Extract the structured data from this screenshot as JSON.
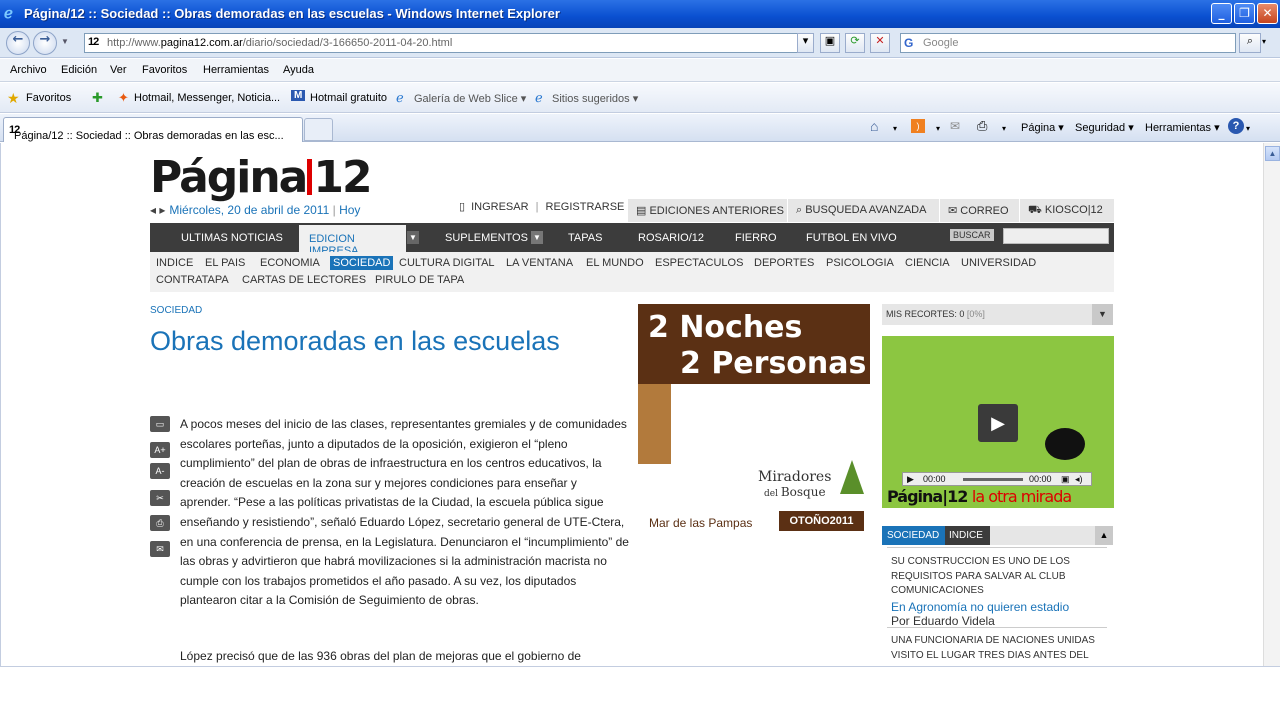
{
  "window": {
    "title": "Página/12 :: Sociedad :: Obras demoradas en las escuelas - Windows Internet Explorer"
  },
  "addressbar": {
    "favicon": "12",
    "url_prefix": "http://www.",
    "url_domain": "pagina12.com.ar",
    "url_path": "/diario/sociedad/3-166650-2011-04-20.html",
    "search_placeholder": "Google"
  },
  "menubar": {
    "items": [
      "Archivo",
      "Edición",
      "Ver",
      "Favoritos",
      "Herramientas",
      "Ayuda"
    ]
  },
  "favoritesbar": {
    "favorites_label": "Favoritos",
    "items": [
      "Hotmail, Messenger, Noticia...",
      "Hotmail gratuito",
      "Galería de Web Slice ▾",
      "Sitios sugeridos ▾"
    ]
  },
  "tabs": {
    "active_label": "Página/12 :: Sociedad :: Obras demoradas en las esc...",
    "tools": [
      "Página ▾",
      "Seguridad ▾",
      "Herramientas ▾"
    ]
  },
  "site": {
    "logo_left": "Página",
    "logo_right": "12",
    "date": "Miércoles, 20 de abril de 2011",
    "date_sep": "|",
    "today": "Hoy",
    "login": "INGRESAR",
    "register": "REGISTRARSE",
    "util_sep": "|",
    "tabs": [
      "EDICIONES ANTERIORES",
      "BUSQUEDA AVANZADA",
      "CORREO",
      "KIOSCO|12"
    ],
    "mainnav": {
      "item0": "ULTIMAS NOTICIAS",
      "active": "EDICION IMPRESA",
      "item2": "SUPLEMENTOS",
      "item3": "TAPAS",
      "item4": "ROSARIO/12",
      "item5": "FIERRO",
      "item6": "FUTBOL EN VIVO",
      "search_btn": "BUSCAR"
    },
    "subnav": [
      "INDICE",
      "EL PAIS",
      "ECONOMIA",
      "SOCIEDAD",
      "CULTURA DIGITAL",
      "LA VENTANA",
      "EL MUNDO",
      "ESPECTACULOS",
      "DEPORTES",
      "PSICOLOGIA",
      "CIENCIA",
      "UNIVERSIDAD",
      "CONTRATAPA",
      "CARTAS DE LECTORES",
      "PIRULO DE TAPA"
    ]
  },
  "article": {
    "section": "SOCIEDAD",
    "headline": "Obras demoradas en las escuelas",
    "para1": "A pocos meses del inicio de las clases, representantes gremiales y de comunidades escolares porteñas, junto a diputados de la oposición, exigieron el “pleno cumplimiento” del plan de obras de infraestructura en los centros educativos, la creación de escuelas en la zona sur y mejores condiciones para enseñar y aprender. “Pese a las políticas privatistas de la Ciudad, la escuela pública sigue enseñando y resistiendo”, señaló Eduardo López, secretario general de UTE-Ctera, en una conferencia de prensa, en la Legislatura. Denunciaron el “incumplimiento” de las obras y advirtieron que habrá movilizaciones si la administración macrista no cumple con los trabajos prometidos el año pasado. A su vez, los diputados plantearon citar a la Comisión de Seguimiento de obras.",
    "para2": "López precisó que de las 936 obras del plan de mejoras que el gobierno de",
    "tools": [
      "A+",
      "A-"
    ]
  },
  "ad": {
    "line1": "2 Noches",
    "line2": "2 Personas",
    "brand_top": "Miradores",
    "brand_mid": "del",
    "brand_bottom": "Bosque",
    "place": "Mar de las Pampas",
    "season": "OTOÑO2011"
  },
  "sidebar": {
    "recortes_label": "MIS RECORTES: 0",
    "recortes_pct": "[0%]",
    "video_time_start": "00:00",
    "video_time_end": "00:00",
    "video_caption_logo": "Página|12",
    "video_caption_tag": "la otra mirada",
    "tab_active": "SOCIEDAD",
    "tab_other": "INDICE",
    "news1_kicker": "SU CONSTRUCCION ES UNO DE LOS REQUISITOS PARA SALVAR AL CLUB COMUNICACIONES",
    "news1_link": "En Agronomía no quieren estadio",
    "news1_author": "Por Eduardo Videla",
    "news2_kicker": "UNA FUNCIONARIA DE NACIONES UNIDAS VISITO EL LUGAR TRES DIAS ANTES DEL"
  },
  "colors": {
    "accent_blue": "#1a73b8",
    "nav_dark": "#3c3c3c",
    "ad_brown": "#5b3014",
    "video_green": "#8cc641"
  }
}
